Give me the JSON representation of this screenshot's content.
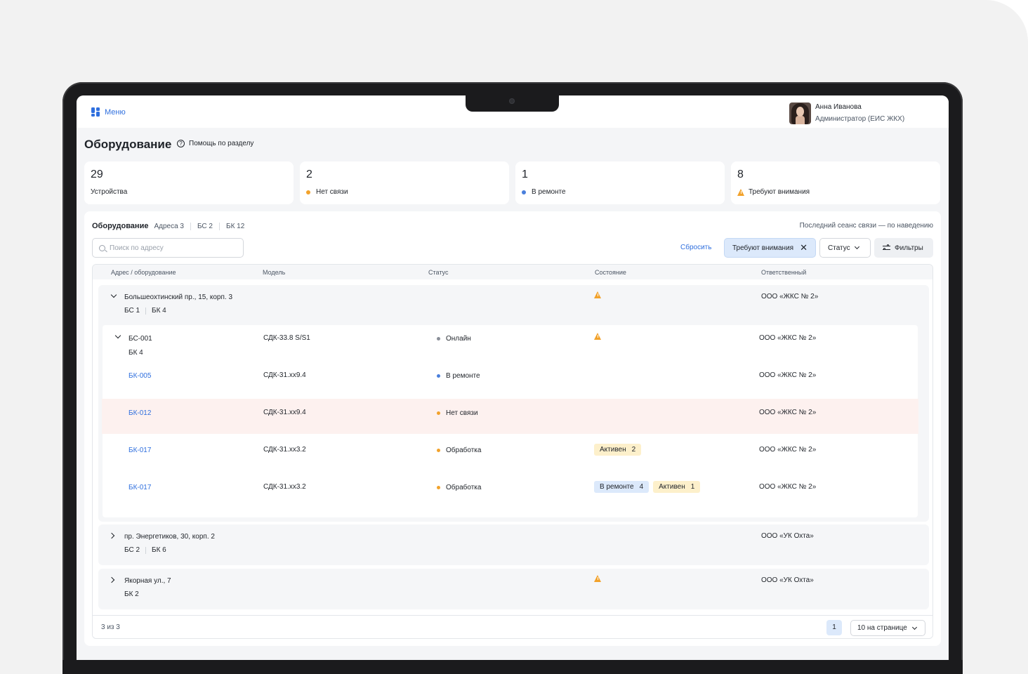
{
  "topbar": {
    "menu_label": "Меню",
    "user_name": "Анна Иванова",
    "user_role": "Администратор (ЕИС ЖКХ)"
  },
  "header": {
    "title": "Оборудование",
    "help_label": "Помощь по разделу"
  },
  "stats": [
    {
      "value": "29",
      "label": "Устройства",
      "marker": "none"
    },
    {
      "value": "2",
      "label": "Нет связи",
      "marker": "dot",
      "color": "#f2a22b"
    },
    {
      "value": "1",
      "label": "В ремонте",
      "marker": "dot",
      "color": "#4a7fdc"
    },
    {
      "value": "8",
      "label": "Требуют внимания",
      "marker": "warning-icon",
      "color": "#f2a22b"
    }
  ],
  "panel": {
    "title": "Оборудование",
    "tabs": [
      "Адреса 3",
      "БС 2",
      "БК 12"
    ],
    "last_session": "Последний сеанс связи — по наведению",
    "search_placeholder": "Поиск по адресу",
    "reset_label": "Сбросить",
    "active_filter": "Требуют внимания",
    "status_label": "Статус",
    "filters_label": "Фильтры"
  },
  "table": {
    "columns": [
      "Адрес / оборудование",
      "Модель",
      "Статус",
      "Состояние",
      "Ответственный"
    ],
    "groups": [
      {
        "address": "Большеохтинский пр., 15, корп. 3",
        "counts": [
          "БС 1",
          "БК 4"
        ],
        "warning": true,
        "responsible": "ООО «ЖКС № 2»",
        "expanded": true,
        "station": {
          "name": "БС-001",
          "sub": "БК 4",
          "model": "СДК-33.8 S/S1",
          "status": "Онлайн",
          "status_color": "#8a8f98",
          "warning": true,
          "responsible": "ООО «ЖКС № 2»"
        },
        "devices": [
          {
            "name": "БК-005",
            "model": "СДК-31.хх9.4",
            "status": "В ремонте",
            "status_color": "#4a7fdc",
            "badges": [],
            "responsible": "ООО «ЖКС № 2»",
            "alert": false
          },
          {
            "name": "БК-012",
            "model": "СДК-31.хх9.4",
            "status": "Нет связи",
            "status_color": "#f2a22b",
            "badges": [],
            "responsible": "ООО «ЖКС № 2»",
            "alert": true
          },
          {
            "name": "БК-017",
            "model": "СДК-31.хх3.2",
            "status": "Обработка",
            "status_color": "#f2a22b",
            "badges": [
              {
                "label": "Активен",
                "count": "2",
                "tone": "yellow"
              }
            ],
            "responsible": "ООО «ЖКС № 2»",
            "alert": false
          },
          {
            "name": "БК-017",
            "model": "СДК-31.хх3.2",
            "status": "Обработка",
            "status_color": "#f2a22b",
            "badges": [
              {
                "label": "В ремонте",
                "count": "4",
                "tone": "blue"
              },
              {
                "label": "Активен",
                "count": "1",
                "tone": "yellow"
              }
            ],
            "responsible": "ООО «ЖКС № 2»",
            "alert": false
          }
        ]
      },
      {
        "address": "пр. Энергетиков, 30, корп. 2",
        "counts": [
          "БС 2",
          "БК 6"
        ],
        "warning": false,
        "responsible": "ООО «УК Охта»",
        "expanded": false
      },
      {
        "address": "Якорная ул., 7",
        "counts": [
          "БК 2"
        ],
        "warning": true,
        "responsible": "ООО «УК Охта»",
        "expanded": false
      }
    ]
  },
  "footer": {
    "count": "3 из 3",
    "page": "1",
    "per_page": "10 на странице"
  }
}
